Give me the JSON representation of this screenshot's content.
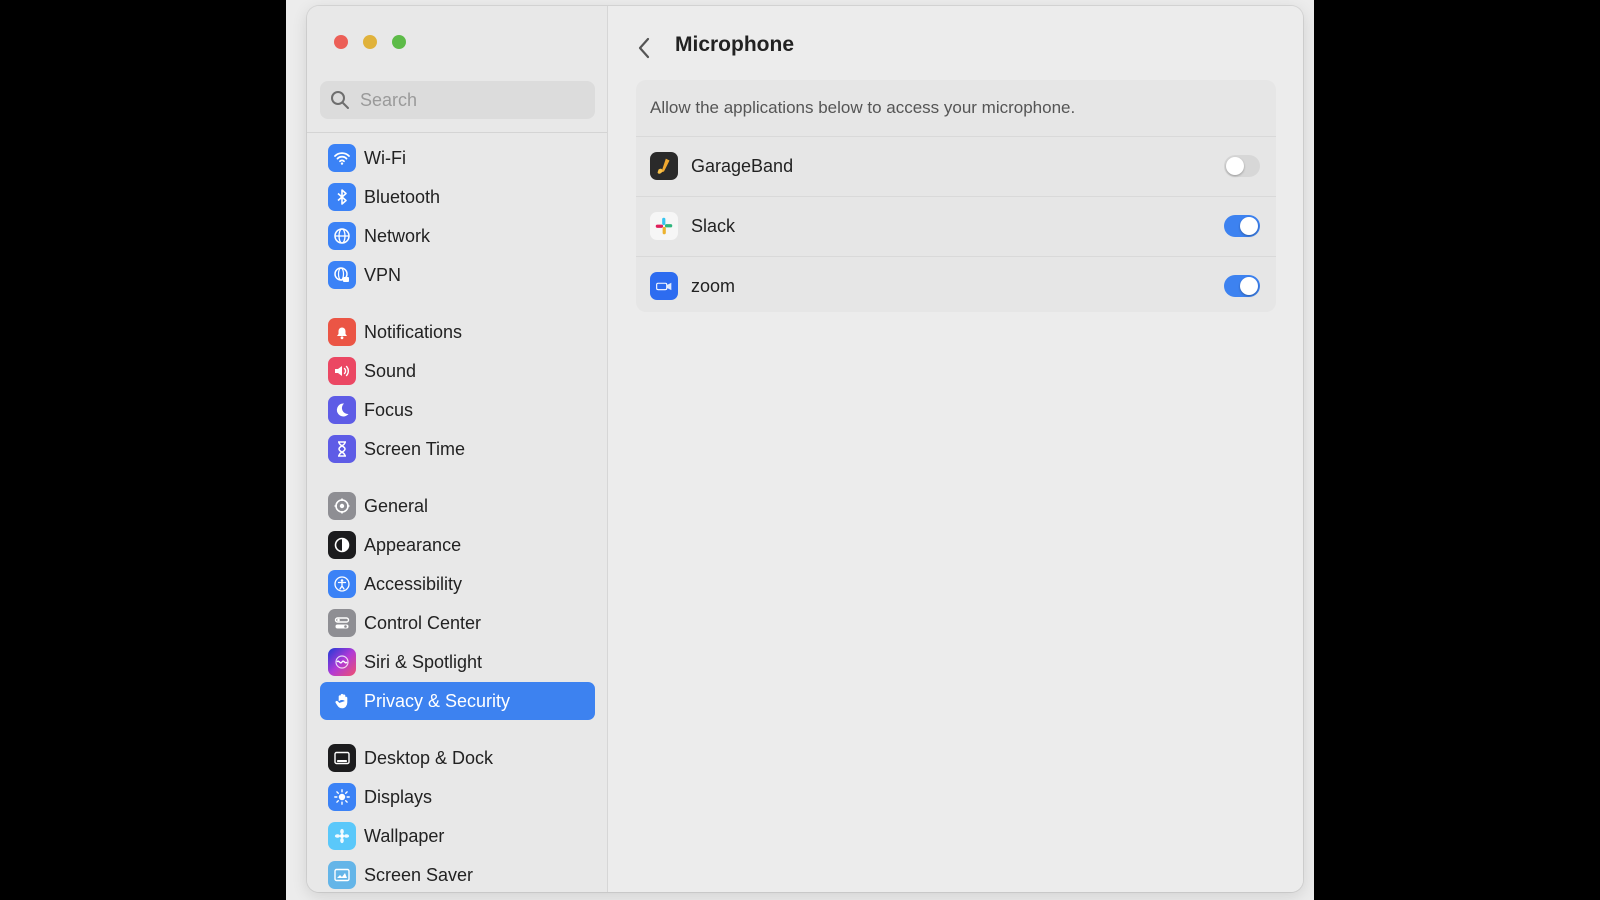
{
  "window": {
    "traffic_lights": [
      "close",
      "minimize",
      "zoom"
    ]
  },
  "search": {
    "placeholder": "Search",
    "value": ""
  },
  "sidebar": {
    "items": [
      {
        "label": "Wi-Fi",
        "icon": "wifi-icon",
        "color": "#3b82f6"
      },
      {
        "label": "Bluetooth",
        "icon": "bluetooth-icon",
        "color": "#3b82f6"
      },
      {
        "label": "Network",
        "icon": "globe-icon",
        "color": "#3b82f6"
      },
      {
        "label": "VPN",
        "icon": "vpn-globe-icon",
        "color": "#3b82f6"
      },
      {
        "label": "Notifications",
        "icon": "bell-icon",
        "color": "#eb5545"
      },
      {
        "label": "Sound",
        "icon": "speaker-icon",
        "color": "#eb4763"
      },
      {
        "label": "Focus",
        "icon": "moon-icon",
        "color": "#5e5ce6"
      },
      {
        "label": "Screen Time",
        "icon": "hourglass-icon",
        "color": "#5e5ce6"
      },
      {
        "label": "General",
        "icon": "gear-icon",
        "color": "#8e8e93"
      },
      {
        "label": "Appearance",
        "icon": "appearance-icon",
        "color": "#1c1c1e"
      },
      {
        "label": "Accessibility",
        "icon": "accessibility-icon",
        "color": "#3b82f6"
      },
      {
        "label": "Control Center",
        "icon": "control-center-icon",
        "color": "#8e8e93"
      },
      {
        "label": "Siri & Spotlight",
        "icon": "siri-icon",
        "color": "#b03ad6"
      },
      {
        "label": "Privacy & Security",
        "icon": "hand-icon",
        "color": "#3d82f0",
        "active": true
      },
      {
        "label": "Desktop & Dock",
        "icon": "dock-icon",
        "color": "#1c1c1e"
      },
      {
        "label": "Displays",
        "icon": "sun-icon",
        "color": "#3b82f6"
      },
      {
        "label": "Wallpaper",
        "icon": "flower-icon",
        "color": "#5ac8fa"
      },
      {
        "label": "Screen Saver",
        "icon": "screensaver-icon",
        "color": "#64b5e8"
      }
    ]
  },
  "main": {
    "title": "Microphone",
    "description": "Allow the applications below to access your microphone.",
    "apps": [
      {
        "name": "GarageBand",
        "icon": "garageband-icon",
        "enabled": false
      },
      {
        "name": "Slack",
        "icon": "slack-icon",
        "enabled": true
      },
      {
        "name": "zoom",
        "icon": "zoom-icon",
        "enabled": true
      }
    ]
  },
  "colors": {
    "accent": "#3d82f0",
    "toggle_off": "#d7d7d7"
  }
}
